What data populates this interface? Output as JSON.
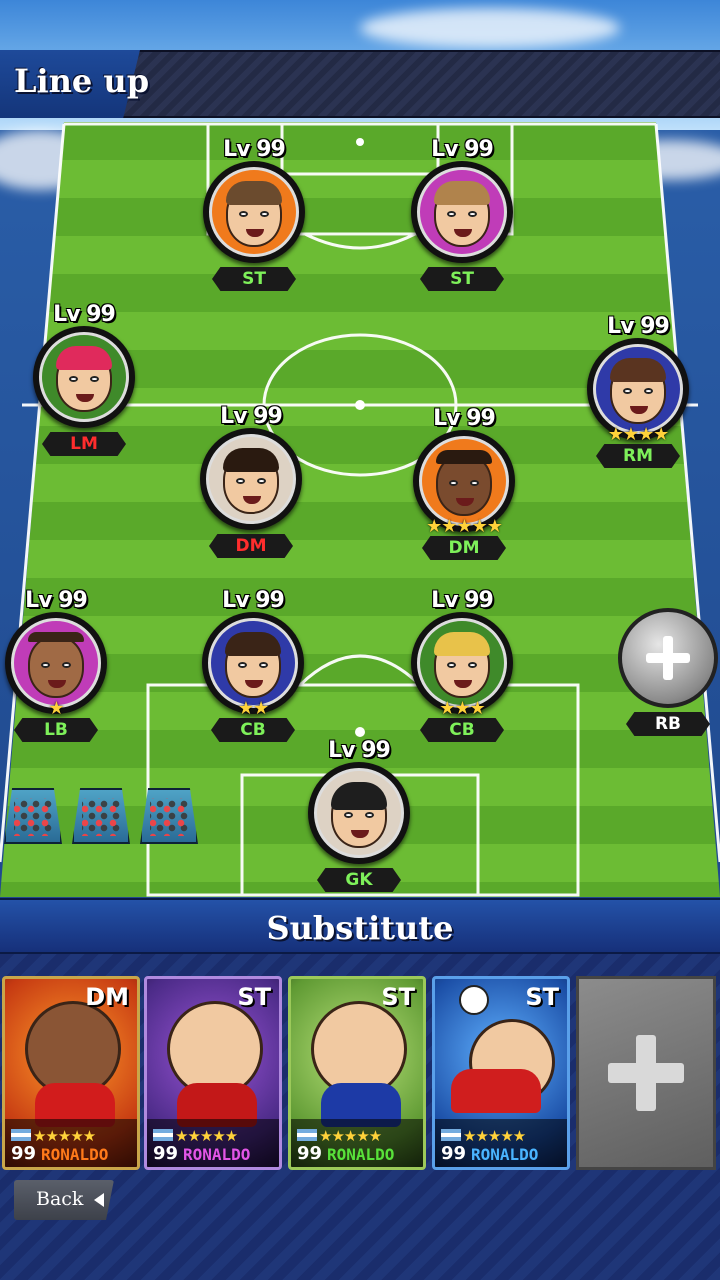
{
  "header": {
    "title": "Line up"
  },
  "lineup": [
    {
      "id": "st-left",
      "lv": "Lv 99",
      "pos": "ST",
      "pos_color": "green",
      "ring": "#f07a1c",
      "stars": ""
    },
    {
      "id": "st-right",
      "lv": "Lv 99",
      "pos": "ST",
      "pos_color": "green",
      "ring": "#c03cb8",
      "stars": ""
    },
    {
      "id": "lm",
      "lv": "Lv 99",
      "pos": "LM",
      "pos_color": "red",
      "ring": "#3f8a2a",
      "stars": ""
    },
    {
      "id": "rm",
      "lv": "Lv 99",
      "pos": "RM",
      "pos_color": "green",
      "ring": "#2f3aa8",
      "stars": "★★★★"
    },
    {
      "id": "dm-left",
      "lv": "Lv 99",
      "pos": "DM",
      "pos_color": "red",
      "ring": "#ddd2c4",
      "stars": ""
    },
    {
      "id": "dm-right",
      "lv": "Lv 99",
      "pos": "DM",
      "pos_color": "green",
      "ring": "#f07a1c",
      "stars": "★★★★★"
    },
    {
      "id": "lb",
      "lv": "Lv 99",
      "pos": "LB",
      "pos_color": "green",
      "ring": "#c03cb8",
      "stars": "★"
    },
    {
      "id": "cb-left",
      "lv": "Lv 99",
      "pos": "CB",
      "pos_color": "green",
      "ring": "#2f3aa8",
      "stars": "★★"
    },
    {
      "id": "cb-right",
      "lv": "Lv 99",
      "pos": "CB",
      "pos_color": "green",
      "ring": "#3f8a2a",
      "stars": "★★★"
    },
    {
      "id": "gk",
      "lv": "Lv 99",
      "pos": "GK",
      "pos_color": "green",
      "ring": "#ddd2c4",
      "stars": ""
    }
  ],
  "empty_slot": {
    "pos": "RB"
  },
  "substitute": {
    "title": "Substitute",
    "cards": [
      {
        "pos": "DM",
        "stars": "★★★★★",
        "level": "99",
        "name": "RONALDO",
        "name_color": "#ff7a1a",
        "bg": "#c63a12",
        "kit": "#d21c1c"
      },
      {
        "pos": "ST",
        "stars": "★★★★★",
        "level": "99",
        "name": "RONALDO",
        "name_color": "#e255e6",
        "bg": "#4a2a86",
        "kit": "#c31818"
      },
      {
        "pos": "ST",
        "stars": "★★★★★",
        "level": "99",
        "name": "RONALDO",
        "name_color": "#58e23a",
        "bg": "#5f9a33",
        "kit": "#1d3aa6"
      },
      {
        "pos": "ST",
        "stars": "★★★★★",
        "level": "99",
        "name": "RONALDO",
        "name_color": "#4ab4ff",
        "bg": "#1b4ea6",
        "kit": "#d01e1e"
      }
    ]
  },
  "footer": {
    "back_label": "Back"
  }
}
